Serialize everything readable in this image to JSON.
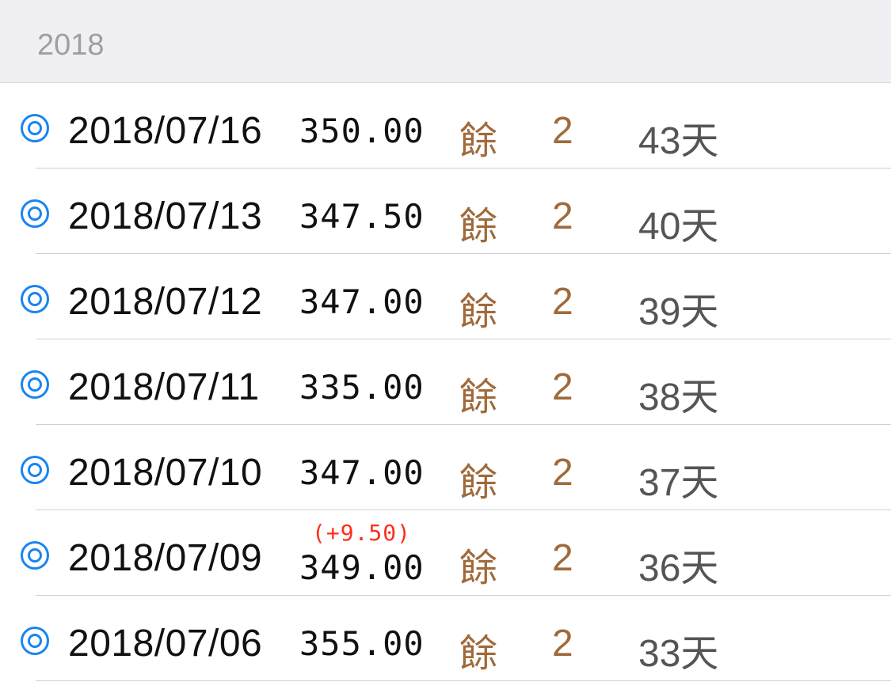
{
  "section": {
    "title": "2018"
  },
  "colors": {
    "bullet": "#1b84f0",
    "remain": "#a06a3a",
    "change": "#ff2d1a",
    "days": "#555555",
    "header_bg": "#efeff4"
  },
  "rows": [
    {
      "icon": "double-circle-icon",
      "date": "2018/07/16",
      "price": "350.00",
      "change": "",
      "remain": "餘",
      "count": "2",
      "days": "43天"
    },
    {
      "icon": "double-circle-icon",
      "date": "2018/07/13",
      "price": "347.50",
      "change": "",
      "remain": "餘",
      "count": "2",
      "days": "40天"
    },
    {
      "icon": "double-circle-icon",
      "date": "2018/07/12",
      "price": "347.00",
      "change": "",
      "remain": "餘",
      "count": "2",
      "days": "39天"
    },
    {
      "icon": "double-circle-icon",
      "date": "2018/07/11",
      "price": "335.00",
      "change": "",
      "remain": "餘",
      "count": "2",
      "days": "38天"
    },
    {
      "icon": "double-circle-icon",
      "date": "2018/07/10",
      "price": "347.00",
      "change": "",
      "remain": "餘",
      "count": "2",
      "days": "37天"
    },
    {
      "icon": "double-circle-icon",
      "date": "2018/07/09",
      "price": "349.00",
      "change": "(+9.50)",
      "remain": "餘",
      "count": "2",
      "days": "36天"
    },
    {
      "icon": "double-circle-icon",
      "date": "2018/07/06",
      "price": "355.00",
      "change": "",
      "remain": "餘",
      "count": "2",
      "days": "33天"
    }
  ]
}
